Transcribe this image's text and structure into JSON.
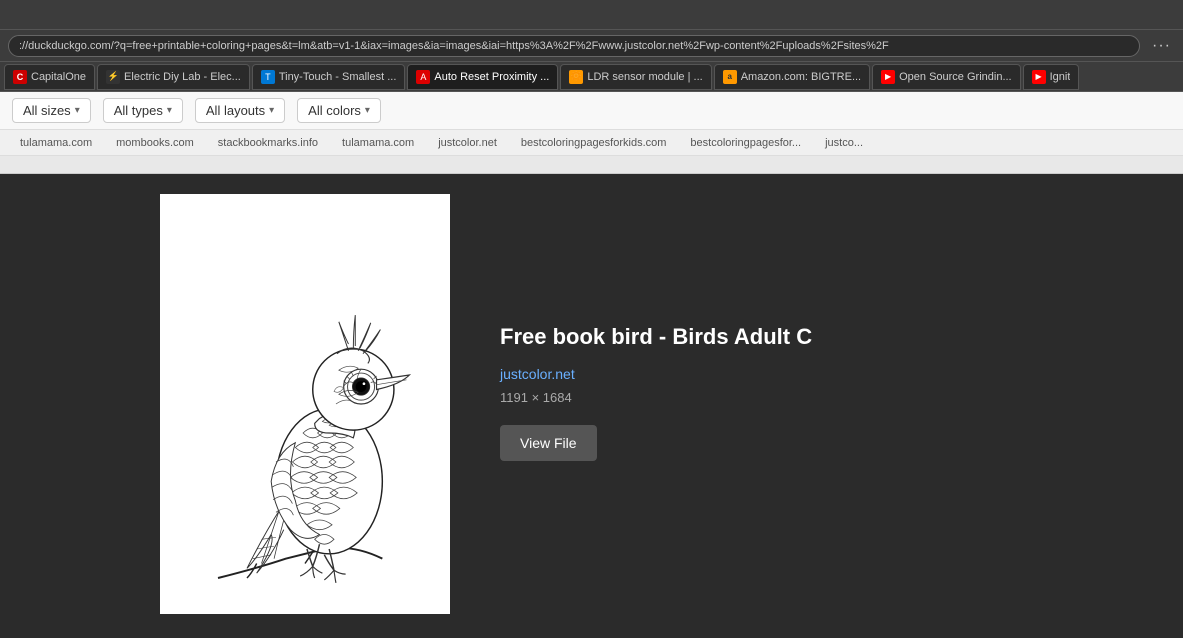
{
  "browser": {
    "address_bar": "://duckduckgo.com/?q=free+printable+coloring+pages&t=lm&atb=v1-1&iax=images&ia=images&iai=https%3A%2F%2Fwww.justcolor.net%2Fwp-content%2Fuploads%2Fsites%2F",
    "dots_menu": "···"
  },
  "tabs": [
    {
      "id": "capitalOne",
      "label": "CapitalOne",
      "favicon_type": "capital",
      "favicon_text": "C"
    },
    {
      "id": "elec",
      "label": "Electric Diy Lab - Elec...",
      "favicon_type": "elec",
      "favicon_text": "⚡"
    },
    {
      "id": "tiny",
      "label": "Tiny-Touch - Smallest ...",
      "favicon_type": "blue",
      "favicon_text": "T"
    },
    {
      "id": "auto",
      "label": "Auto Reset Proximity ...",
      "favicon_type": "red",
      "favicon_text": "A",
      "active": true
    },
    {
      "id": "ldr",
      "label": "LDR sensor module | ...",
      "favicon_type": "orange",
      "favicon_text": "🔆"
    },
    {
      "id": "amazon",
      "label": "Amazon.com: BIGTRE...",
      "favicon_type": "amazon",
      "favicon_text": "a"
    },
    {
      "id": "opensource",
      "label": "Open Source Grindin...",
      "favicon_type": "yt",
      "favicon_text": "▶"
    },
    {
      "id": "ignit",
      "label": "Ignit",
      "favicon_type": "yt",
      "favicon_text": "▶"
    }
  ],
  "filters": [
    {
      "id": "sizes",
      "label": "All sizes",
      "has_arrow": true
    },
    {
      "id": "types",
      "label": "All types",
      "has_arrow": true
    },
    {
      "id": "layouts",
      "label": "All layouts",
      "has_arrow": true
    },
    {
      "id": "colors",
      "label": "All colors",
      "has_arrow": true
    }
  ],
  "domains": [
    "tulamama.com",
    "mombooks.com",
    "stackbookmarks.info",
    "tulamama.com",
    "justcolor.net",
    "bestcoloringpagesforkids.com",
    "bestcoloringpagesfor...",
    "justco..."
  ],
  "image_info": {
    "title": "Free book bird - Birds Adult C",
    "source": "justcolor.net",
    "dimensions": "1191 × 1684",
    "view_file_label": "View File"
  }
}
